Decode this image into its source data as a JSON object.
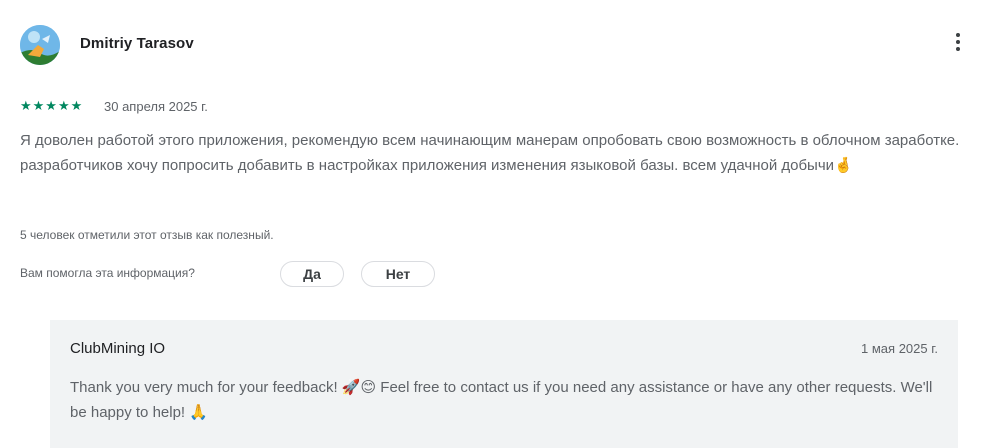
{
  "review": {
    "author": "Dmitriy Tarasov",
    "rating": 5,
    "stars": "★★★★★",
    "date": "30 апреля 2025 г.",
    "text": "Я доволен работой этого приложения, рекомендую всем начинающим манерам опробовать свою возможность в облочном заработке. разработчиков хочу попросить добавить в настройках приложения изменения языковой базы. всем удачной добычи🤞",
    "helpful_count": "5 человек отметили этот отзыв как полезный.",
    "helpful_question": "Вам помогла эта информация?",
    "yes_label": "Да",
    "no_label": "Нет"
  },
  "developer_reply": {
    "name": "ClubMining IO",
    "date": "1 мая 2025 г.",
    "text": "Thank you very much for your feedback! 🚀😊 Feel free to contact us if you need any assistance or have any other requests. We'll be happy to help! 🙏"
  },
  "colors": {
    "star": "#01875f",
    "reply_background": "#f1f3f4",
    "secondary_text": "#5f6368"
  },
  "icons": {
    "avatar": "avatar-image",
    "menu": "more-vert-icon"
  }
}
